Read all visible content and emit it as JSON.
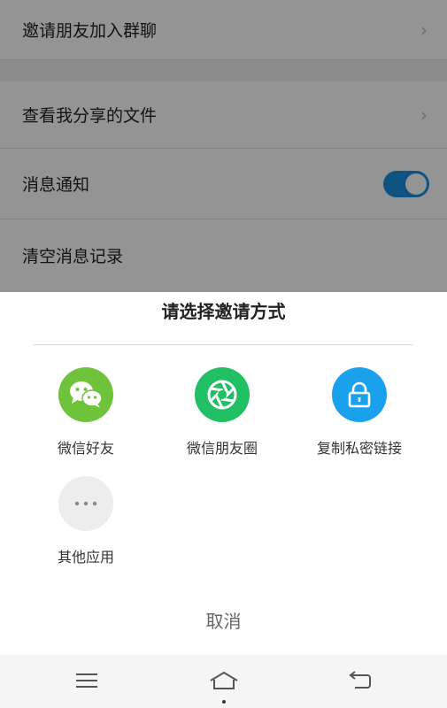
{
  "settings": {
    "items": [
      {
        "label": "邀请朋友加入群聊"
      },
      {
        "label": "查看我分享的文件"
      },
      {
        "label": "消息通知"
      },
      {
        "label": "清空消息记录"
      }
    ],
    "notification_toggle_on": true
  },
  "sheet": {
    "title": "请选择邀请方式",
    "options": [
      {
        "label": "微信好友",
        "icon": "wechat-icon",
        "color": "#6fc33a"
      },
      {
        "label": "微信朋友圈",
        "icon": "moments-icon",
        "color": "#21c065"
      },
      {
        "label": "复制私密链接",
        "icon": "lock-icon",
        "color": "#1aa1ee"
      },
      {
        "label": "其他应用",
        "icon": "more-dots-icon",
        "color": "#ededed"
      }
    ],
    "cancel_label": "取消"
  },
  "colors": {
    "toggle_on": "#1a8fe0",
    "overlay": "rgba(0,0,0,0.42)"
  }
}
